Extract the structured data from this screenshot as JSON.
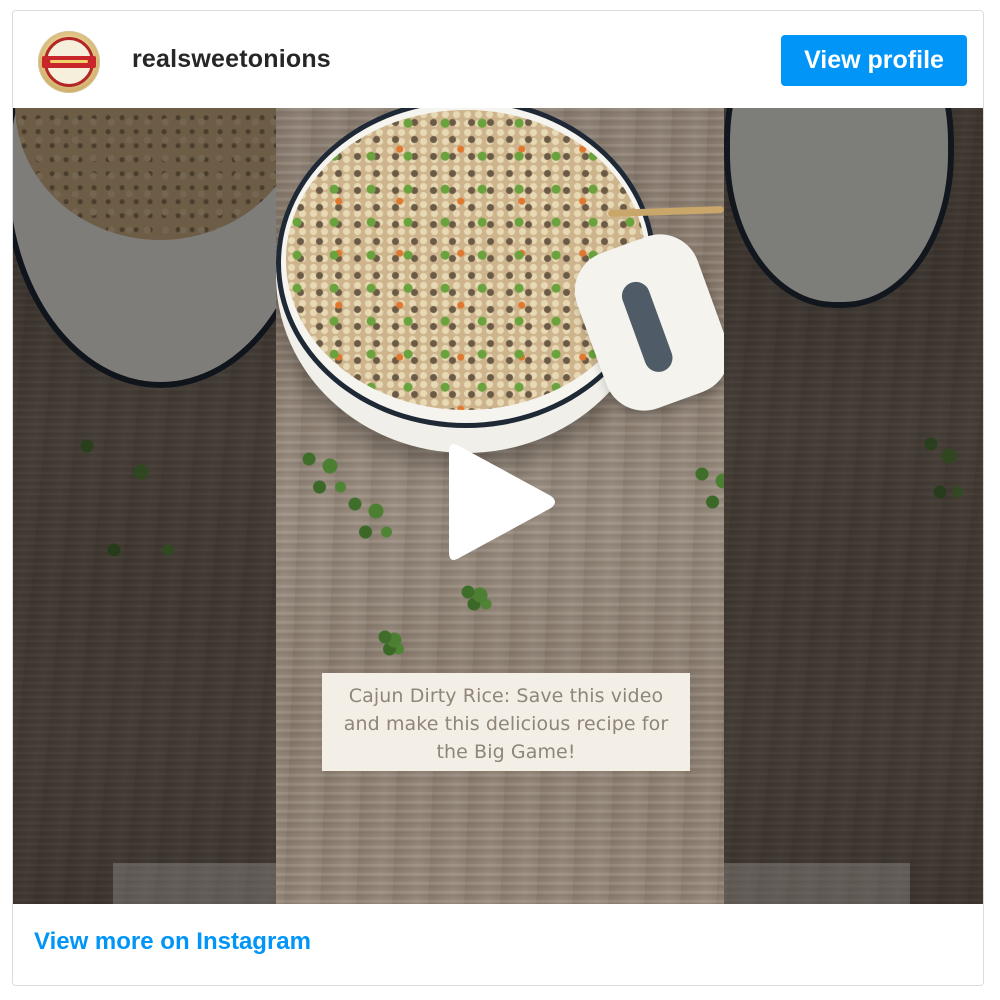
{
  "header": {
    "username": "realsweetonions",
    "view_profile_label": "View profile"
  },
  "media": {
    "caption": "Cajun Dirty Rice: Save this video and make this delicious recipe for the Big Game!",
    "play_icon": "play-icon"
  },
  "footer": {
    "link_label": "View more on Instagram"
  },
  "colors": {
    "accent": "#0095f6",
    "text_primary": "#262626",
    "caption_bg": "#f3efe7",
    "caption_text": "#8f8578"
  }
}
